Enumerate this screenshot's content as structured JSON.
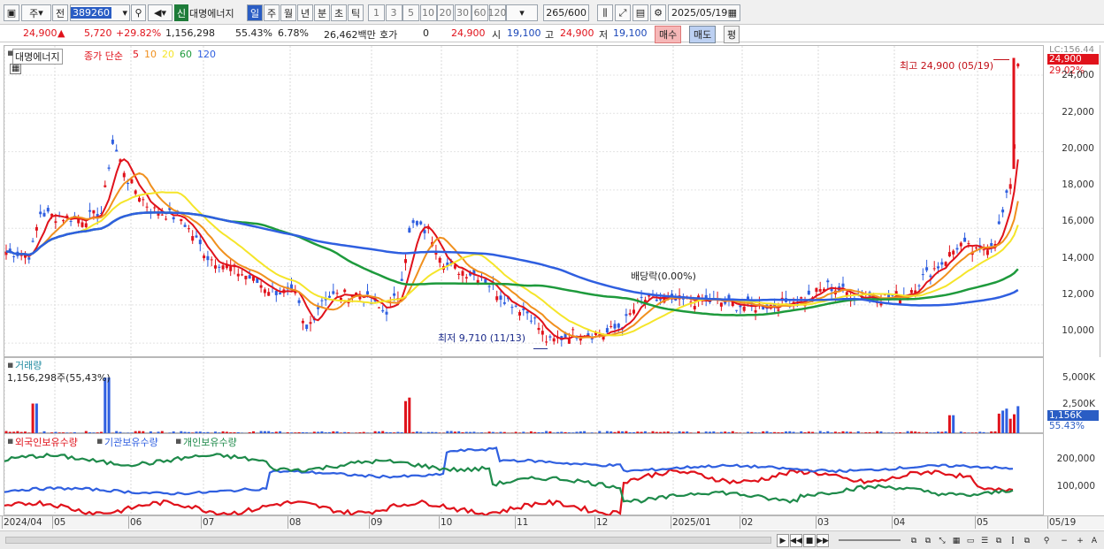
{
  "toolbar": {
    "market": "주",
    "prev_label": "전",
    "code": "389260",
    "new_badge": "신",
    "stock_name": "대명에너지",
    "periods": [
      "일",
      "주",
      "월",
      "년",
      "분",
      "초",
      "틱"
    ],
    "active_period": "일",
    "intervals": [
      "1",
      "3",
      "5",
      "10",
      "20",
      "30",
      "60",
      "120"
    ],
    "count": "265",
    "count_total": "/600",
    "date": "2025/05/19"
  },
  "quote": {
    "price": "24,900",
    "change": "5,720",
    "change_pct": "+29.82%",
    "volume": "1,156,298",
    "volume_pct": "55.43%",
    "turnover": "6.78%",
    "amount": "26,462백만",
    "hoga_label": "호가",
    "hoga_value": "0",
    "ask": "24,900",
    "open_label": "시",
    "open": "19,100",
    "high_label": "고",
    "high": "24,900",
    "low_label": "저",
    "low": "19,100",
    "buy": "매수",
    "sell": "매도",
    "avg": "평"
  },
  "price_panel": {
    "name": "대명에너지",
    "ma_title": "종가 단순",
    "ma_periods": [
      "5",
      "10",
      "20",
      "60",
      "120"
    ],
    "ma_colors": [
      "#e0121b",
      "#f0901e",
      "#f5e52a",
      "#1e9a3c",
      "#2f5fe0"
    ],
    "high_note": "최고 24,900 (05/19)",
    "low_note": "최저 9,710 (11/13)",
    "dividend_note": "배당락(0.00%)",
    "axis_top_label": "LC:156.44",
    "current_badge": "24,900",
    "current_pct": "29.02%",
    "ticks": [
      "24,000",
      "22,000",
      "20,000",
      "18,000",
      "16,000",
      "14,000",
      "12,000",
      "10,000"
    ]
  },
  "volume_panel": {
    "title": "거래량",
    "value_text": "1,156,298주(55,43%)",
    "ticks": [
      "5,000K",
      "2,500K"
    ],
    "current_badge": "1,156K",
    "current_pct": "55.43%"
  },
  "holdings_panel": {
    "labels": [
      "외국인보유수량",
      "기관보유수량",
      "개인보유수량"
    ],
    "colors": [
      "#e0121b",
      "#2f5fe0",
      "#1e8a4a"
    ],
    "ticks": [
      "200,000",
      "100,000"
    ]
  },
  "dates": [
    "2024/04",
    "05",
    "06",
    "07",
    "08",
    "09",
    "10",
    "11",
    "12",
    "2025/01",
    "02",
    "03",
    "04",
    "05",
    "05/19"
  ],
  "chart_data": {
    "type": "line",
    "title": "",
    "series": [
      {
        "name": "대명에너지 종가",
        "x": [
          "2024/04",
          "05",
          "06",
          "07",
          "08",
          "09",
          "10",
          "11",
          "12",
          "2025/01",
          "02",
          "03",
          "04",
          "05",
          "05/19"
        ],
        "values": [
          14500,
          16500,
          18000,
          15500,
          12800,
          12000,
          15500,
          13000,
          10200,
          12200,
          12000,
          12300,
          12500,
          15000,
          24900
        ]
      }
    ],
    "ylim": [
      9500,
      25200
    ],
    "max": {
      "value": 24900,
      "date": "05/19"
    },
    "min": {
      "value": 9710,
      "date": "11/13"
    }
  }
}
